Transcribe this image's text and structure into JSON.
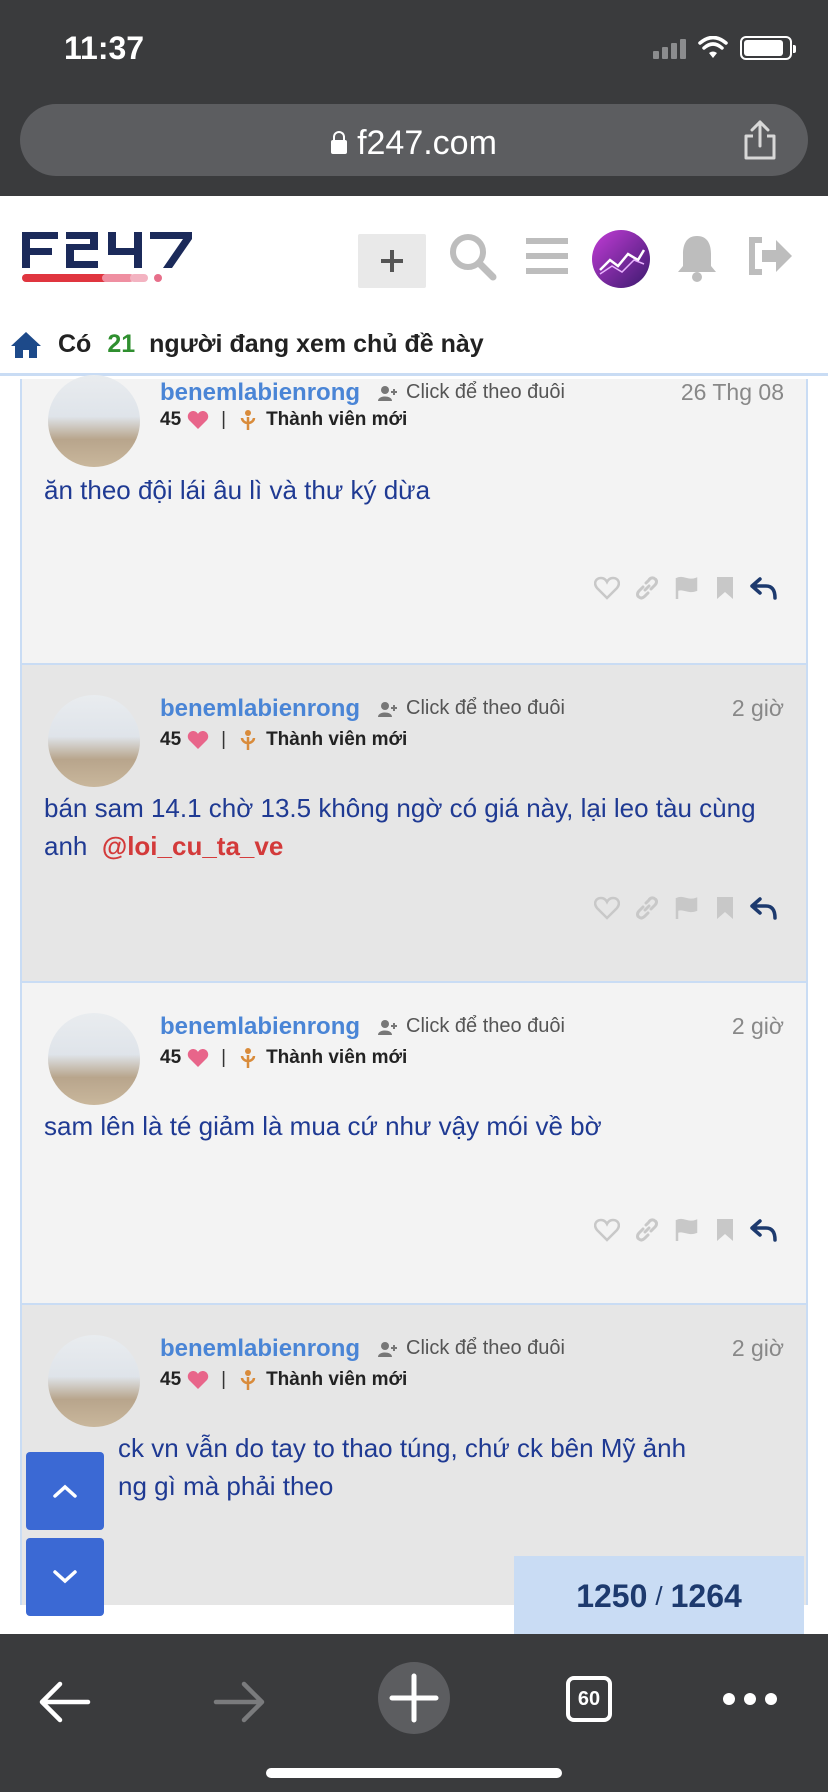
{
  "status": {
    "time": "11:37"
  },
  "browser": {
    "url": "f247.com",
    "tab_count": "60"
  },
  "site": {
    "viewing": {
      "prefix": "Có",
      "count": "21",
      "suffix": "người đang xem chủ đề này"
    }
  },
  "posts": [
    {
      "username": "benemlabienrong",
      "follow_label": "Click để theo đuôi",
      "date": "26 Thg 08",
      "likes": "45",
      "rank": "Thành viên mới",
      "body": "ăn theo đội lái âu lì và thư ký dừa"
    },
    {
      "username": "benemlabienrong",
      "follow_label": "Click để theo đuôi",
      "date": "2 giờ",
      "likes": "45",
      "rank": "Thành viên mới",
      "body": "bán sam 14.1 chờ 13.5 không ngờ có giá này, lại leo tàu cùng anh",
      "mention": "@loi_cu_ta_ve"
    },
    {
      "username": "benemlabienrong",
      "follow_label": "Click để theo đuôi",
      "date": "2 giờ",
      "likes": "45",
      "rank": "Thành viên mới",
      "body": "sam lên là té giảm là mua cứ như vậy mói về bờ"
    },
    {
      "username": "benemlabienrong",
      "follow_label": "Click để theo đuôi",
      "date": "2 giờ",
      "likes": "45",
      "rank": "Thành viên mới",
      "body_line1": "ck vn vẫn do tay to thao túng, chứ ck bên Mỹ ảnh",
      "body_line2": "ng gì mà phải theo"
    }
  ],
  "progress": {
    "current": "1250",
    "separator": "/",
    "total": "1264"
  },
  "icons": {
    "header": [
      "plus-icon",
      "search-icon",
      "menu-icon",
      "user-avatar",
      "bell-icon",
      "logout-icon"
    ],
    "post_actions": [
      "heart-icon",
      "link-icon",
      "flag-icon",
      "bookmark-icon",
      "reply-icon"
    ]
  },
  "colors": {
    "username": "#4a85d6",
    "body": "#1f3a93",
    "mention": "#d33a3a",
    "viewing_count": "#2f8f2f",
    "scroll_button": "#3b69d4",
    "progress_bg": "#c9dcf4"
  }
}
